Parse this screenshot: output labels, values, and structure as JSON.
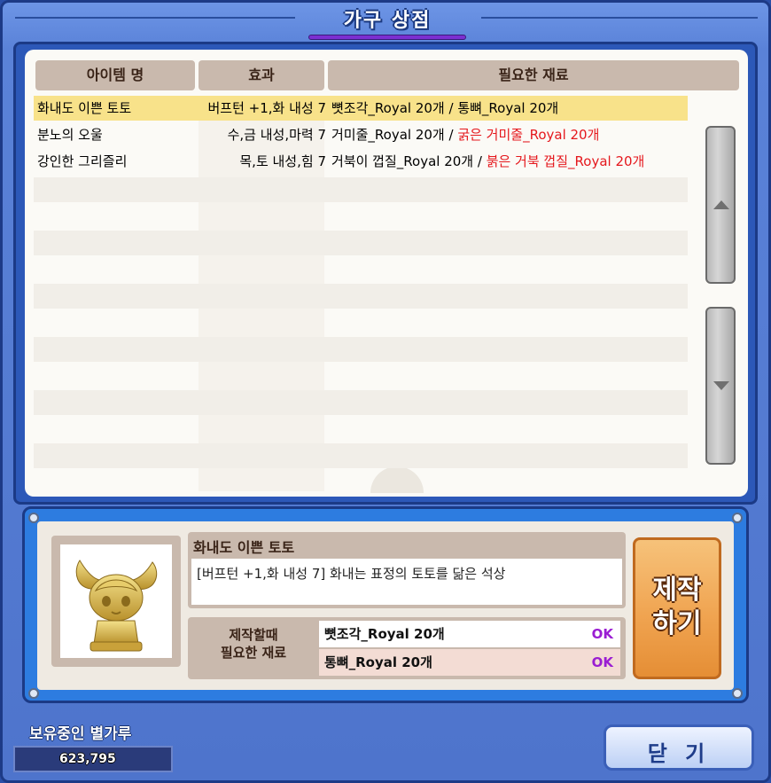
{
  "window": {
    "title": "가구 상점"
  },
  "list": {
    "headers": {
      "name": "아이템 명",
      "effect": "효과",
      "materials": "필요한 재료"
    },
    "rows": [
      {
        "name": "화내도 이쁜 토토",
        "effect": "버프턴 +1,화 내성 7",
        "material_a": "뼛조각_Royal 20개",
        "separator": " / ",
        "material_b": "통뼈_Royal 20개",
        "material_b_missing": false,
        "selected": true
      },
      {
        "name": "분노의 오울",
        "effect": "수,금 내성,마력 7",
        "material_a": "거미줄_Royal 20개",
        "separator": " / ",
        "material_b": "굵은 거미줄_Royal 20개",
        "material_b_missing": true,
        "selected": false
      },
      {
        "name": "강인한 그리즐리",
        "effect": "목,토 내성,힘 7",
        "material_a": "거북이 껍질_Royal 20개",
        "separator": " / ",
        "material_b": "붉은 거북 껍질_Royal 20개",
        "material_b_missing": true,
        "selected": false
      }
    ]
  },
  "detail": {
    "item_name": "화내도 이쁜 토토",
    "description": "[버프턴 +1,화 내성 7] 화내는 표정의 토토를 닮은 석상",
    "needed_label_line1": "제작할때",
    "needed_label_line2": "필요한 재료",
    "needed": [
      {
        "material": "뼛조각_Royal 20개",
        "status": "OK"
      },
      {
        "material": "통뼈_Royal 20개",
        "status": "OK"
      }
    ],
    "make_button_line1": "제작",
    "make_button_line2": "하기"
  },
  "footer": {
    "stardust_label": "보유중인 별가루",
    "stardust_value": "623,795",
    "close_button": "닫 기"
  },
  "colors": {
    "missing_material": "#e5181d",
    "ok_status": "#9a1dd2",
    "selected_row": "#f8e28a"
  }
}
